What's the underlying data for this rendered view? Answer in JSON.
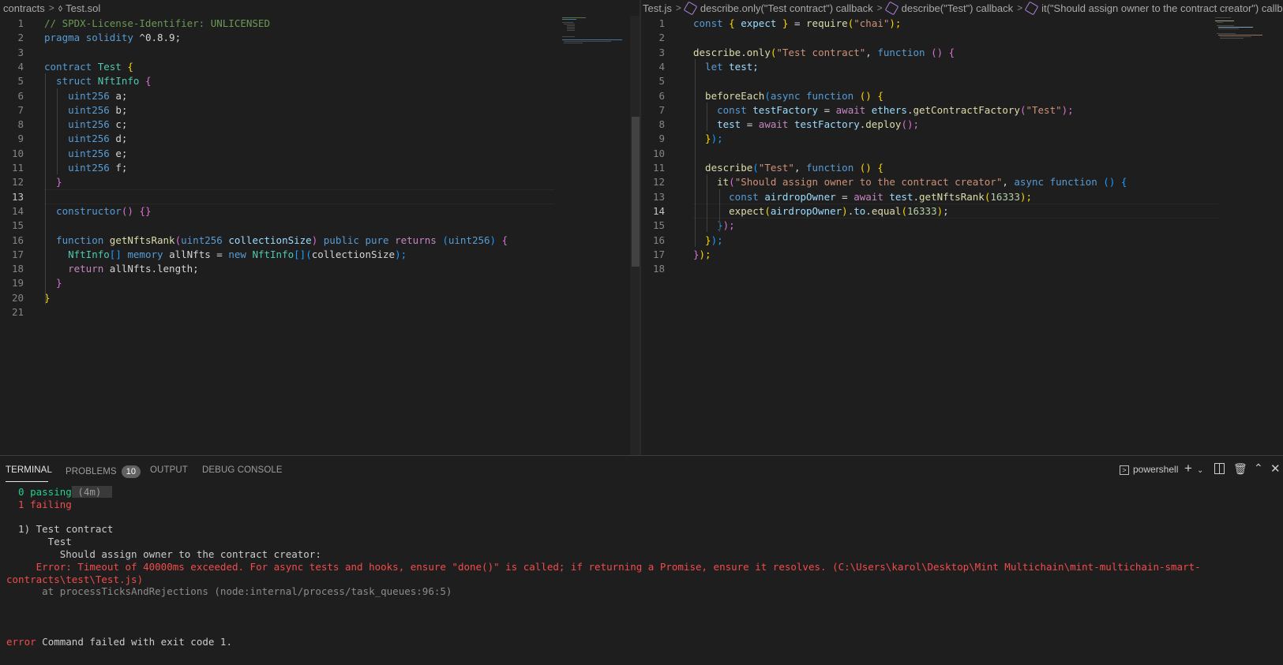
{
  "left_editor": {
    "breadcrumb": [
      "contracts",
      "Test.sol"
    ],
    "current_line": 13,
    "lines": [
      {
        "n": "1",
        "tokens": [
          [
            "// SPDX-License-Identifier: UNLICENSED",
            "t-comment"
          ]
        ]
      },
      {
        "n": "2",
        "tokens": [
          [
            "pragma ",
            "t-kw"
          ],
          [
            "solidity ",
            "t-kw"
          ],
          [
            "^0.8.9;",
            "t-plain"
          ]
        ]
      },
      {
        "n": "3",
        "tokens": []
      },
      {
        "n": "4",
        "tokens": [
          [
            "contract ",
            "t-kw"
          ],
          [
            "Test ",
            "t-type"
          ],
          [
            "{",
            "t-b1"
          ]
        ]
      },
      {
        "n": "5",
        "tokens": [
          [
            "  struct ",
            "t-kw"
          ],
          [
            "NftInfo ",
            "t-type"
          ],
          [
            "{",
            "t-b2"
          ]
        ]
      },
      {
        "n": "6",
        "tokens": [
          [
            "    uint256 ",
            "t-kw"
          ],
          [
            "a;",
            "t-plain"
          ]
        ]
      },
      {
        "n": "7",
        "tokens": [
          [
            "    uint256 ",
            "t-kw"
          ],
          [
            "b;",
            "t-plain"
          ]
        ]
      },
      {
        "n": "8",
        "tokens": [
          [
            "    uint256 ",
            "t-kw"
          ],
          [
            "c;",
            "t-plain"
          ]
        ]
      },
      {
        "n": "9",
        "tokens": [
          [
            "    uint256 ",
            "t-kw"
          ],
          [
            "d;",
            "t-plain"
          ]
        ]
      },
      {
        "n": "10",
        "tokens": [
          [
            "    uint256 ",
            "t-kw"
          ],
          [
            "e;",
            "t-plain"
          ]
        ]
      },
      {
        "n": "11",
        "tokens": [
          [
            "    uint256 ",
            "t-kw"
          ],
          [
            "f;",
            "t-plain"
          ]
        ]
      },
      {
        "n": "12",
        "tokens": [
          [
            "  }",
            "t-b2"
          ]
        ]
      },
      {
        "n": "13",
        "tokens": []
      },
      {
        "n": "14",
        "tokens": [
          [
            "  constructor",
            "t-kw"
          ],
          [
            "()",
            "t-b2"
          ],
          [
            " ",
            "t-plain"
          ],
          [
            "{}",
            "t-b2"
          ]
        ]
      },
      {
        "n": "15",
        "tokens": []
      },
      {
        "n": "16",
        "tokens": [
          [
            "  function ",
            "t-kw"
          ],
          [
            "getNftsRank",
            "t-fn"
          ],
          [
            "(",
            "t-b2"
          ],
          [
            "uint256 ",
            "t-kw"
          ],
          [
            "collectionSize",
            "t-var"
          ],
          [
            ") ",
            "t-b2"
          ],
          [
            "public ",
            "t-kw"
          ],
          [
            "pure ",
            "t-kw"
          ],
          [
            "returns ",
            "t-ctrl"
          ],
          [
            "(",
            "t-b3"
          ],
          [
            "uint256",
            "t-kw"
          ],
          [
            ") ",
            "t-b3"
          ],
          [
            "{",
            "t-b2"
          ]
        ]
      },
      {
        "n": "17",
        "tokens": [
          [
            "    NftInfo",
            "t-type"
          ],
          [
            "[] ",
            "t-b3"
          ],
          [
            "memory ",
            "t-kw"
          ],
          [
            "allNfts = ",
            "t-plain"
          ],
          [
            "new ",
            "t-kw"
          ],
          [
            "NftInfo",
            "t-type"
          ],
          [
            "[]",
            "t-b3"
          ],
          [
            "(",
            "t-b3"
          ],
          [
            "collectionSize",
            "t-plain"
          ],
          [
            ");",
            "t-b3"
          ]
        ]
      },
      {
        "n": "18",
        "tokens": [
          [
            "    return ",
            "t-ctrl"
          ],
          [
            "allNfts.length;",
            "t-plain"
          ]
        ]
      },
      {
        "n": "19",
        "tokens": [
          [
            "  }",
            "t-b2"
          ]
        ]
      },
      {
        "n": "20",
        "tokens": [
          [
            "}",
            "t-b1"
          ]
        ]
      },
      {
        "n": "21",
        "tokens": []
      }
    ]
  },
  "right_editor": {
    "breadcrumb": [
      "Test.js",
      "describe.only(\"Test contract\") callback",
      "describe(\"Test\") callback",
      "it(\"Should assign owner to the contract creator\") callba"
    ],
    "current_line": 14,
    "lines": [
      {
        "n": "1",
        "tokens": [
          [
            "const ",
            "t-kw"
          ],
          [
            "{ ",
            "t-b1"
          ],
          [
            "expect ",
            "t-var"
          ],
          [
            "} ",
            "t-b1"
          ],
          [
            "= ",
            "t-plain"
          ],
          [
            "require",
            "t-fn"
          ],
          [
            "(",
            "t-b1"
          ],
          [
            "\"chai\"",
            "t-str"
          ],
          [
            ");",
            "t-b1"
          ]
        ]
      },
      {
        "n": "2",
        "tokens": []
      },
      {
        "n": "3",
        "tokens": [
          [
            "describe",
            "t-fn"
          ],
          [
            ".",
            "t-plain"
          ],
          [
            "only",
            "t-fn"
          ],
          [
            "(",
            "t-b1"
          ],
          [
            "\"Test contract\"",
            "t-str"
          ],
          [
            ", ",
            "t-plain"
          ],
          [
            "function ",
            "t-kw"
          ],
          [
            "() ",
            "t-b2"
          ],
          [
            "{",
            "t-b2"
          ]
        ]
      },
      {
        "n": "4",
        "tokens": [
          [
            "  let ",
            "t-kw"
          ],
          [
            "test;",
            "t-var"
          ]
        ]
      },
      {
        "n": "5",
        "tokens": []
      },
      {
        "n": "6",
        "tokens": [
          [
            "  beforeEach",
            "t-fn"
          ],
          [
            "(",
            "t-b3"
          ],
          [
            "async ",
            "t-kw"
          ],
          [
            "function ",
            "t-kw"
          ],
          [
            "() ",
            "t-b1"
          ],
          [
            "{",
            "t-b1"
          ]
        ]
      },
      {
        "n": "7",
        "tokens": [
          [
            "    const ",
            "t-kw"
          ],
          [
            "testFactory ",
            "t-var"
          ],
          [
            "= ",
            "t-plain"
          ],
          [
            "await ",
            "t-ctrl"
          ],
          [
            "ethers",
            "t-var"
          ],
          [
            ".",
            "t-plain"
          ],
          [
            "getContractFactory",
            "t-fn"
          ],
          [
            "(",
            "t-b2"
          ],
          [
            "\"Test\"",
            "t-str"
          ],
          [
            ");",
            "t-b2"
          ]
        ]
      },
      {
        "n": "8",
        "tokens": [
          [
            "    test ",
            "t-var"
          ],
          [
            "= ",
            "t-plain"
          ],
          [
            "await ",
            "t-ctrl"
          ],
          [
            "testFactory",
            "t-var"
          ],
          [
            ".",
            "t-plain"
          ],
          [
            "deploy",
            "t-fn"
          ],
          [
            "();",
            "t-b2"
          ]
        ]
      },
      {
        "n": "9",
        "tokens": [
          [
            "  }",
            "t-b1"
          ],
          [
            ");",
            "t-b3"
          ]
        ]
      },
      {
        "n": "10",
        "tokens": []
      },
      {
        "n": "11",
        "tokens": [
          [
            "  describe",
            "t-fn"
          ],
          [
            "(",
            "t-b3"
          ],
          [
            "\"Test\"",
            "t-str"
          ],
          [
            ", ",
            "t-plain"
          ],
          [
            "function ",
            "t-kw"
          ],
          [
            "() ",
            "t-b1"
          ],
          [
            "{",
            "t-b1"
          ]
        ]
      },
      {
        "n": "12",
        "tokens": [
          [
            "    it",
            "t-fn"
          ],
          [
            "(",
            "t-b2"
          ],
          [
            "\"Should assign owner to the contract creator\"",
            "t-str"
          ],
          [
            ", ",
            "t-plain"
          ],
          [
            "async ",
            "t-kw"
          ],
          [
            "function ",
            "t-kw"
          ],
          [
            "() ",
            "t-b3"
          ],
          [
            "{",
            "t-b3"
          ]
        ]
      },
      {
        "n": "13",
        "tokens": [
          [
            "      const ",
            "t-kw"
          ],
          [
            "airdropOwner ",
            "t-var"
          ],
          [
            "= ",
            "t-plain"
          ],
          [
            "await ",
            "t-ctrl"
          ],
          [
            "test",
            "t-var"
          ],
          [
            ".",
            "t-plain"
          ],
          [
            "getNftsRank",
            "t-fn"
          ],
          [
            "(",
            "t-b1"
          ],
          [
            "16333",
            "t-num"
          ],
          [
            ");",
            "t-b1"
          ]
        ]
      },
      {
        "n": "14",
        "tokens": [
          [
            "      expect",
            "t-fn"
          ],
          [
            "(",
            "t-b1"
          ],
          [
            "airdropOwner",
            "t-var"
          ],
          [
            ")",
            "t-b1"
          ],
          [
            ".",
            "t-plain"
          ],
          [
            "to",
            "t-var"
          ],
          [
            ".",
            "t-plain"
          ],
          [
            "equal",
            "t-fn"
          ],
          [
            "(",
            "t-b1"
          ],
          [
            "16333",
            "t-num"
          ],
          [
            ")",
            "t-b1"
          ],
          [
            ";",
            "t-plain"
          ]
        ]
      },
      {
        "n": "15",
        "tokens": [
          [
            "    }",
            "t-b3"
          ],
          [
            ");",
            "t-b2"
          ]
        ]
      },
      {
        "n": "16",
        "tokens": [
          [
            "  }",
            "t-b1"
          ],
          [
            ");",
            "t-b3"
          ]
        ]
      },
      {
        "n": "17",
        "tokens": [
          [
            "}",
            "t-b2"
          ],
          [
            ");",
            "t-b1"
          ]
        ]
      },
      {
        "n": "18",
        "tokens": []
      }
    ]
  },
  "panel": {
    "tabs": {
      "terminal": "TERMINAL",
      "problems": "PROBLEMS",
      "output": "OUTPUT",
      "debug": "DEBUG CONSOLE"
    },
    "problems_count": "10",
    "shell_label": "powershell",
    "lines": [
      {
        "y": 0,
        "parts": [
          [
            "  0 passing",
            "t-green"
          ],
          [
            " (4m)",
            "t-dur"
          ]
        ]
      },
      {
        "y": 1,
        "parts": [
          [
            "  1 failing",
            "t-red"
          ]
        ]
      },
      {
        "y": 2,
        "parts": []
      },
      {
        "y": 3,
        "parts": [
          [
            "  1) Test contract",
            ""
          ]
        ]
      },
      {
        "y": 4,
        "parts": [
          [
            "       Test",
            ""
          ]
        ]
      },
      {
        "y": 5,
        "parts": [
          [
            "         Should assign owner to the contract creator:",
            ""
          ]
        ]
      },
      {
        "y": 6,
        "parts": [
          [
            "     Error: Timeout of 40000ms exceeded. For async tests and hooks, ensure \"done()\" is called; if returning a Promise, ensure it resolves. (C:\\Users\\karol\\Desktop\\Mint Multichain\\mint-multichain-smart-",
            "t-red"
          ]
        ]
      },
      {
        "y": 7,
        "parts": [
          [
            "contracts\\test\\Test.js)",
            "t-red"
          ]
        ]
      },
      {
        "y": 8,
        "parts": [
          [
            "      at processTicksAndRejections (node:internal/process/task_queues:96:5)",
            "t-gray"
          ]
        ]
      },
      {
        "y": 9,
        "parts": []
      },
      {
        "y": 10,
        "parts": []
      },
      {
        "y": 11,
        "parts": []
      },
      {
        "y": 12,
        "parts": [
          [
            "error",
            "t-red"
          ],
          [
            " Command failed with exit code 1.",
            ""
          ]
        ]
      }
    ]
  }
}
